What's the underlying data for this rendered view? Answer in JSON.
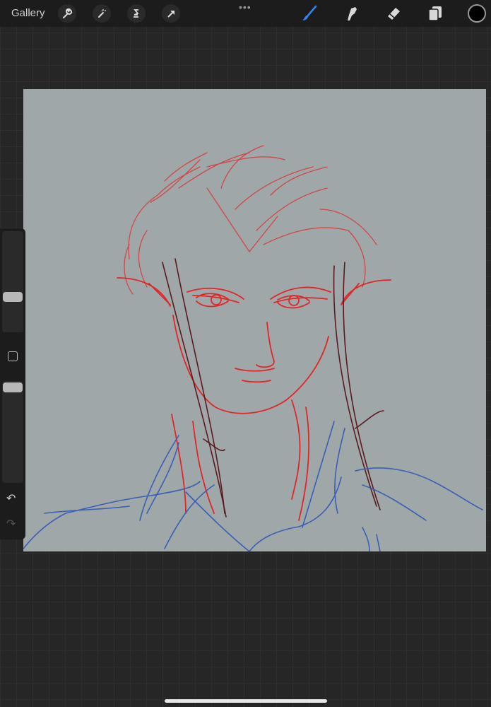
{
  "toolbar": {
    "gallery_label": "Gallery",
    "left_tools": [
      "wrench-icon",
      "magic-wand-icon",
      "selection-s-icon",
      "transform-arrow-icon"
    ],
    "more_label": "•••",
    "right_tools": [
      "brush-icon",
      "smudge-icon",
      "eraser-icon",
      "layers-icon"
    ],
    "active_tool": "brush",
    "current_color": "#000000",
    "accent": "#2f86f5"
  },
  "sidebar": {
    "brush_size": 0.35,
    "brush_opacity": 0.95,
    "undo_icon": "↶",
    "redo_icon": "↷"
  },
  "canvas": {
    "background": "#9fa7a8",
    "stroke_colors": {
      "red": "#e0262a",
      "dark": "#5a1a1f",
      "blue": "#3b5fb5"
    }
  }
}
